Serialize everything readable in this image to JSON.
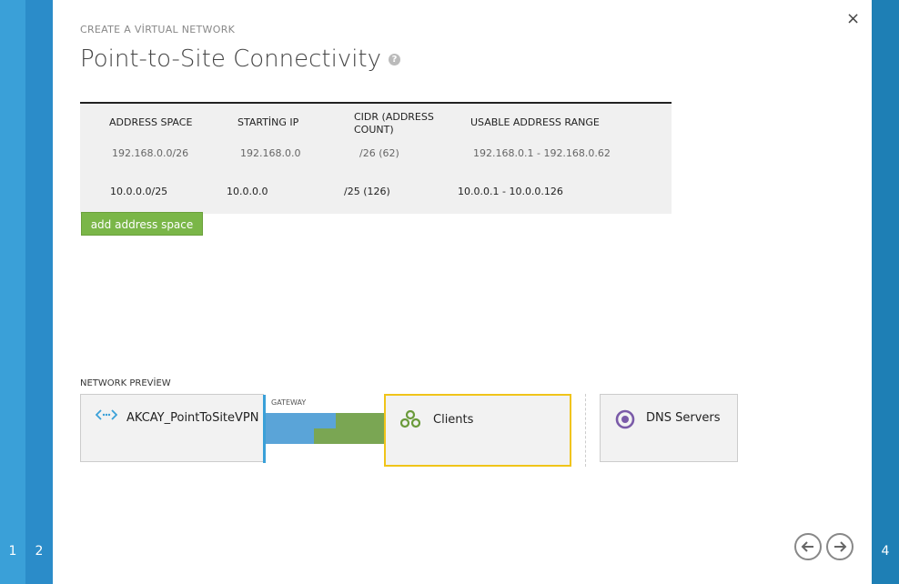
{
  "wizard": {
    "steps": [
      {
        "label": "1"
      },
      {
        "label": "2"
      },
      {
        "label": "4"
      }
    ],
    "subtitle": "CREATE A VİRTUAL NETWORK",
    "title": "Point-to-Site Connectivity",
    "close_symbol": "×"
  },
  "table": {
    "headers": [
      "ADDRESS SPACE",
      "STARTİNG IP",
      "CIDR (ADDRESS COUNT)",
      "USABLE ADDRESS RANGE"
    ],
    "rows": [
      [
        "192.168.0.0/26",
        "192.168.0.0",
        "/26 (62)",
        "192.168.0.1 - 192.168.0.62"
      ],
      [
        "10.0.0.0/25",
        "10.0.0.0",
        "/25 (126)",
        "10.0.0.1 - 10.0.0.126"
      ]
    ]
  },
  "add_address_space": "add address space",
  "preview": {
    "label": "NETWORK PREVİEW",
    "network_name": "AKCAY_PointToSiteVPN",
    "gateway_label": "GATEWAY",
    "clients_label": "Clients",
    "dns_label": "DNS Servers"
  },
  "colors": {
    "accent_blue": "#3aa0d8",
    "green": "#7ab648",
    "highlight": "#f0c419"
  },
  "icons": {
    "help": "help-icon",
    "network": "network-arrows-icon",
    "clients": "clients-icon",
    "dns": "dns-icon",
    "back": "arrow-left-icon",
    "next": "arrow-right-icon"
  }
}
